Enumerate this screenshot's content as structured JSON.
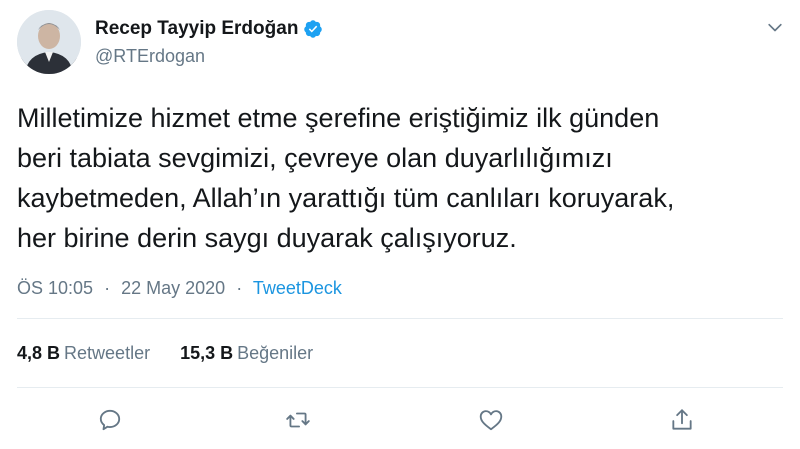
{
  "user": {
    "display_name": "Recep Tayyip Erdoğan",
    "handle": "@RTErdogan",
    "verified": true,
    "avatar_icon": "profile-photo"
  },
  "tweet": {
    "text": "Milletimize hizmet etme şerefine eriştiğimiz ilk günden\nberi tabiata sevgimizi, çevreye olan duyarlılığımızı\nkaybetmeden, Allah’ın yarattığı tüm canlıları koruyarak,\nher birine derin saygı duyarak çalışıyoruz.",
    "time": "ÖS 10:05",
    "separator": "·",
    "date": "22 May 2020",
    "source": "TweetDeck"
  },
  "stats": {
    "retweets_count": "4,8 B",
    "retweets_label": "Retweetler",
    "likes_count": "15,3 B",
    "likes_label": "Beğeniler"
  },
  "icons": {
    "reply": "reply-icon",
    "retweet": "retweet-icon",
    "like": "heart-icon",
    "share": "share-icon",
    "caret": "chevron-down-icon",
    "verified": "verified-badge-icon"
  },
  "colors": {
    "text": "#14171a",
    "secondary": "#657786",
    "link": "#1b95e0",
    "verified": "#1da1f2",
    "divider": "#e6ecf0"
  }
}
